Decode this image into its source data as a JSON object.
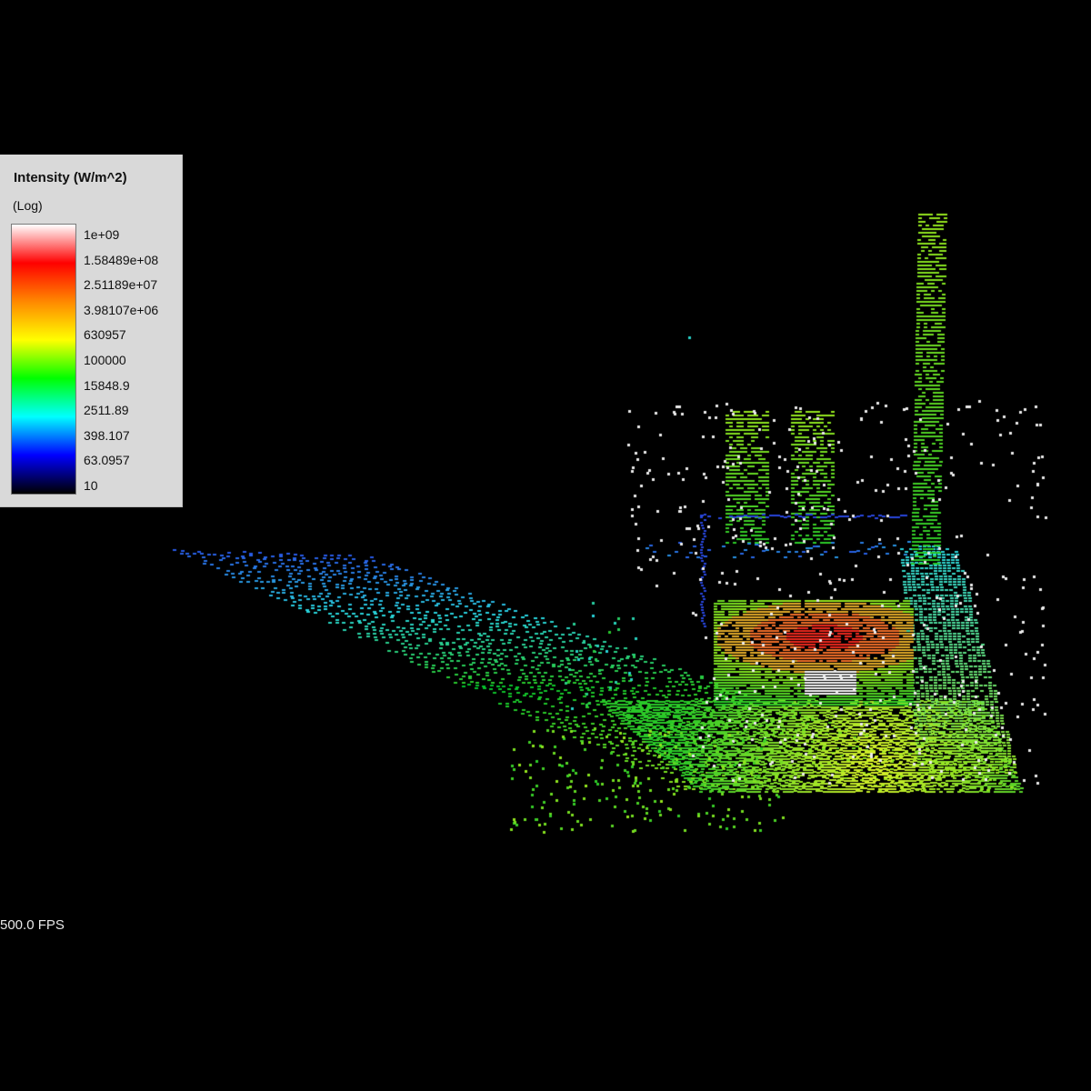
{
  "legend": {
    "title": "Intensity (W/m^2)",
    "scale_label": "(Log)",
    "ticks": [
      "1e+09",
      "1.58489e+08",
      "2.51189e+07",
      "3.98107e+06",
      "630957",
      "100000",
      "15848.9",
      "2511.89",
      "398.107",
      "63.0957",
      "10"
    ],
    "colormap": [
      "#ffffff",
      "#ff0000",
      "#ff8800",
      "#ffff00",
      "#00ff00",
      "#00ffff",
      "#0000ff",
      "#000000"
    ]
  },
  "status": {
    "fps": "500.0 FPS"
  },
  "colors": {
    "background": "#000000",
    "legend_panel": "#d9d9d9"
  }
}
